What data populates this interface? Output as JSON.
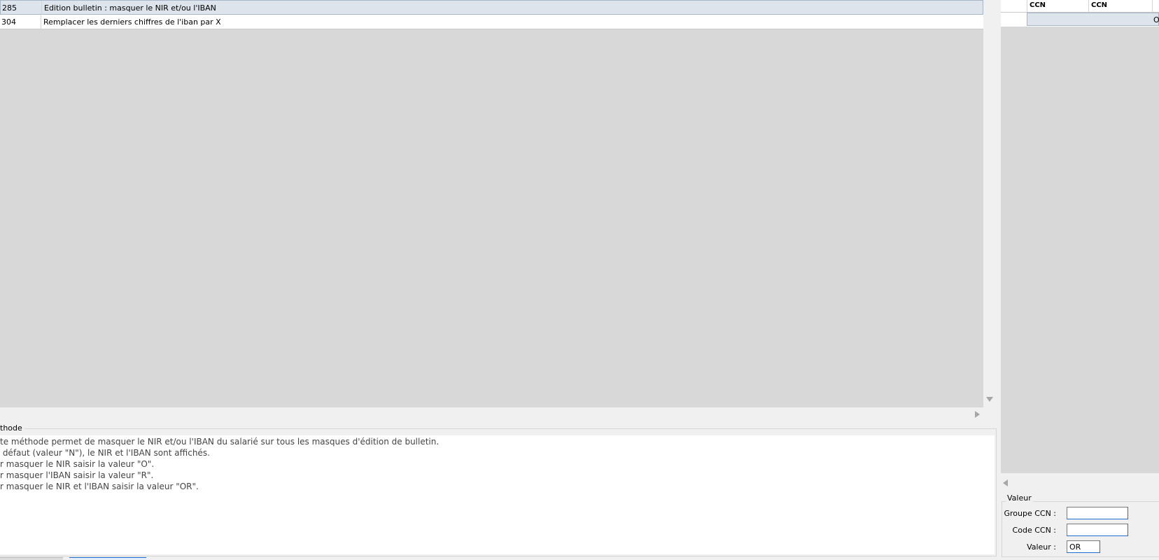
{
  "methods_grid": {
    "rows": [
      {
        "num": "285",
        "label": "Edition bulletin : masquer le NIR et/ou l'IBAN",
        "selected": true
      },
      {
        "num": "304",
        "label": "Remplacer les derniers chiffres de l'iban par X",
        "selected": false
      }
    ]
  },
  "description": {
    "title": "thode",
    "lines": [
      "te méthode permet de masquer le NIR et/ou l'IBAN du salarié sur tous les masques d'édition de bulletin.",
      " défaut (valeur \"N\"), le NIR et l'IBAN sont affichés.",
      "r masquer le NIR saisir la valeur \"O\".",
      "r masquer l'IBAN saisir la valeur \"R\".",
      "r masquer le NIR et l'IBAN saisir la valeur \"OR\"."
    ]
  },
  "ccn_grid": {
    "headers": [
      "CCN",
      "CCN"
    ],
    "row_value": "O"
  },
  "valeur_panel": {
    "title": "Valeur",
    "groupe_label": "Groupe CCN :",
    "groupe_value": "",
    "code_label": "Code CCN :",
    "code_value": "",
    "valeur_label": "Valeur :",
    "valeur_value": "OR"
  },
  "colors": {
    "selection": "#dde4ec",
    "focus_border": "#1c6fd0",
    "grid_empty": "#d8d8d8"
  }
}
